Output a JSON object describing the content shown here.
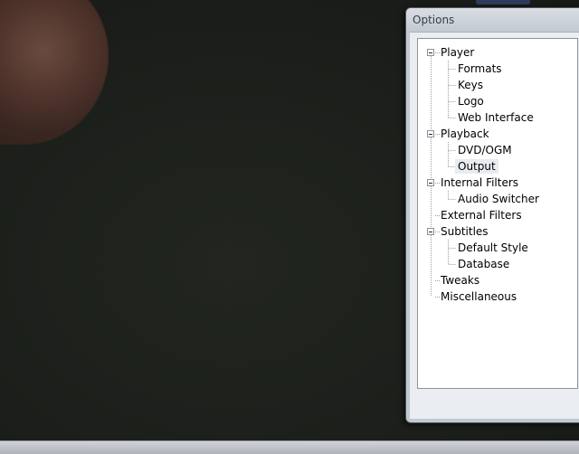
{
  "options_window": {
    "title": "Options",
    "tree": [
      {
        "label": "Player",
        "children": [
          {
            "label": "Formats"
          },
          {
            "label": "Keys"
          },
          {
            "label": "Logo"
          },
          {
            "label": "Web Interface"
          }
        ]
      },
      {
        "label": "Playback",
        "children": [
          {
            "label": "DVD/OGM"
          },
          {
            "label": "Output",
            "selected": true
          }
        ]
      },
      {
        "label": "Internal Filters",
        "children": [
          {
            "label": "Audio Switcher"
          }
        ]
      },
      {
        "label": "External Filters"
      },
      {
        "label": "Subtitles",
        "children": [
          {
            "label": "Default Style"
          },
          {
            "label": "Database"
          }
        ]
      },
      {
        "label": "Tweaks"
      },
      {
        "label": "Miscellaneous"
      }
    ]
  }
}
